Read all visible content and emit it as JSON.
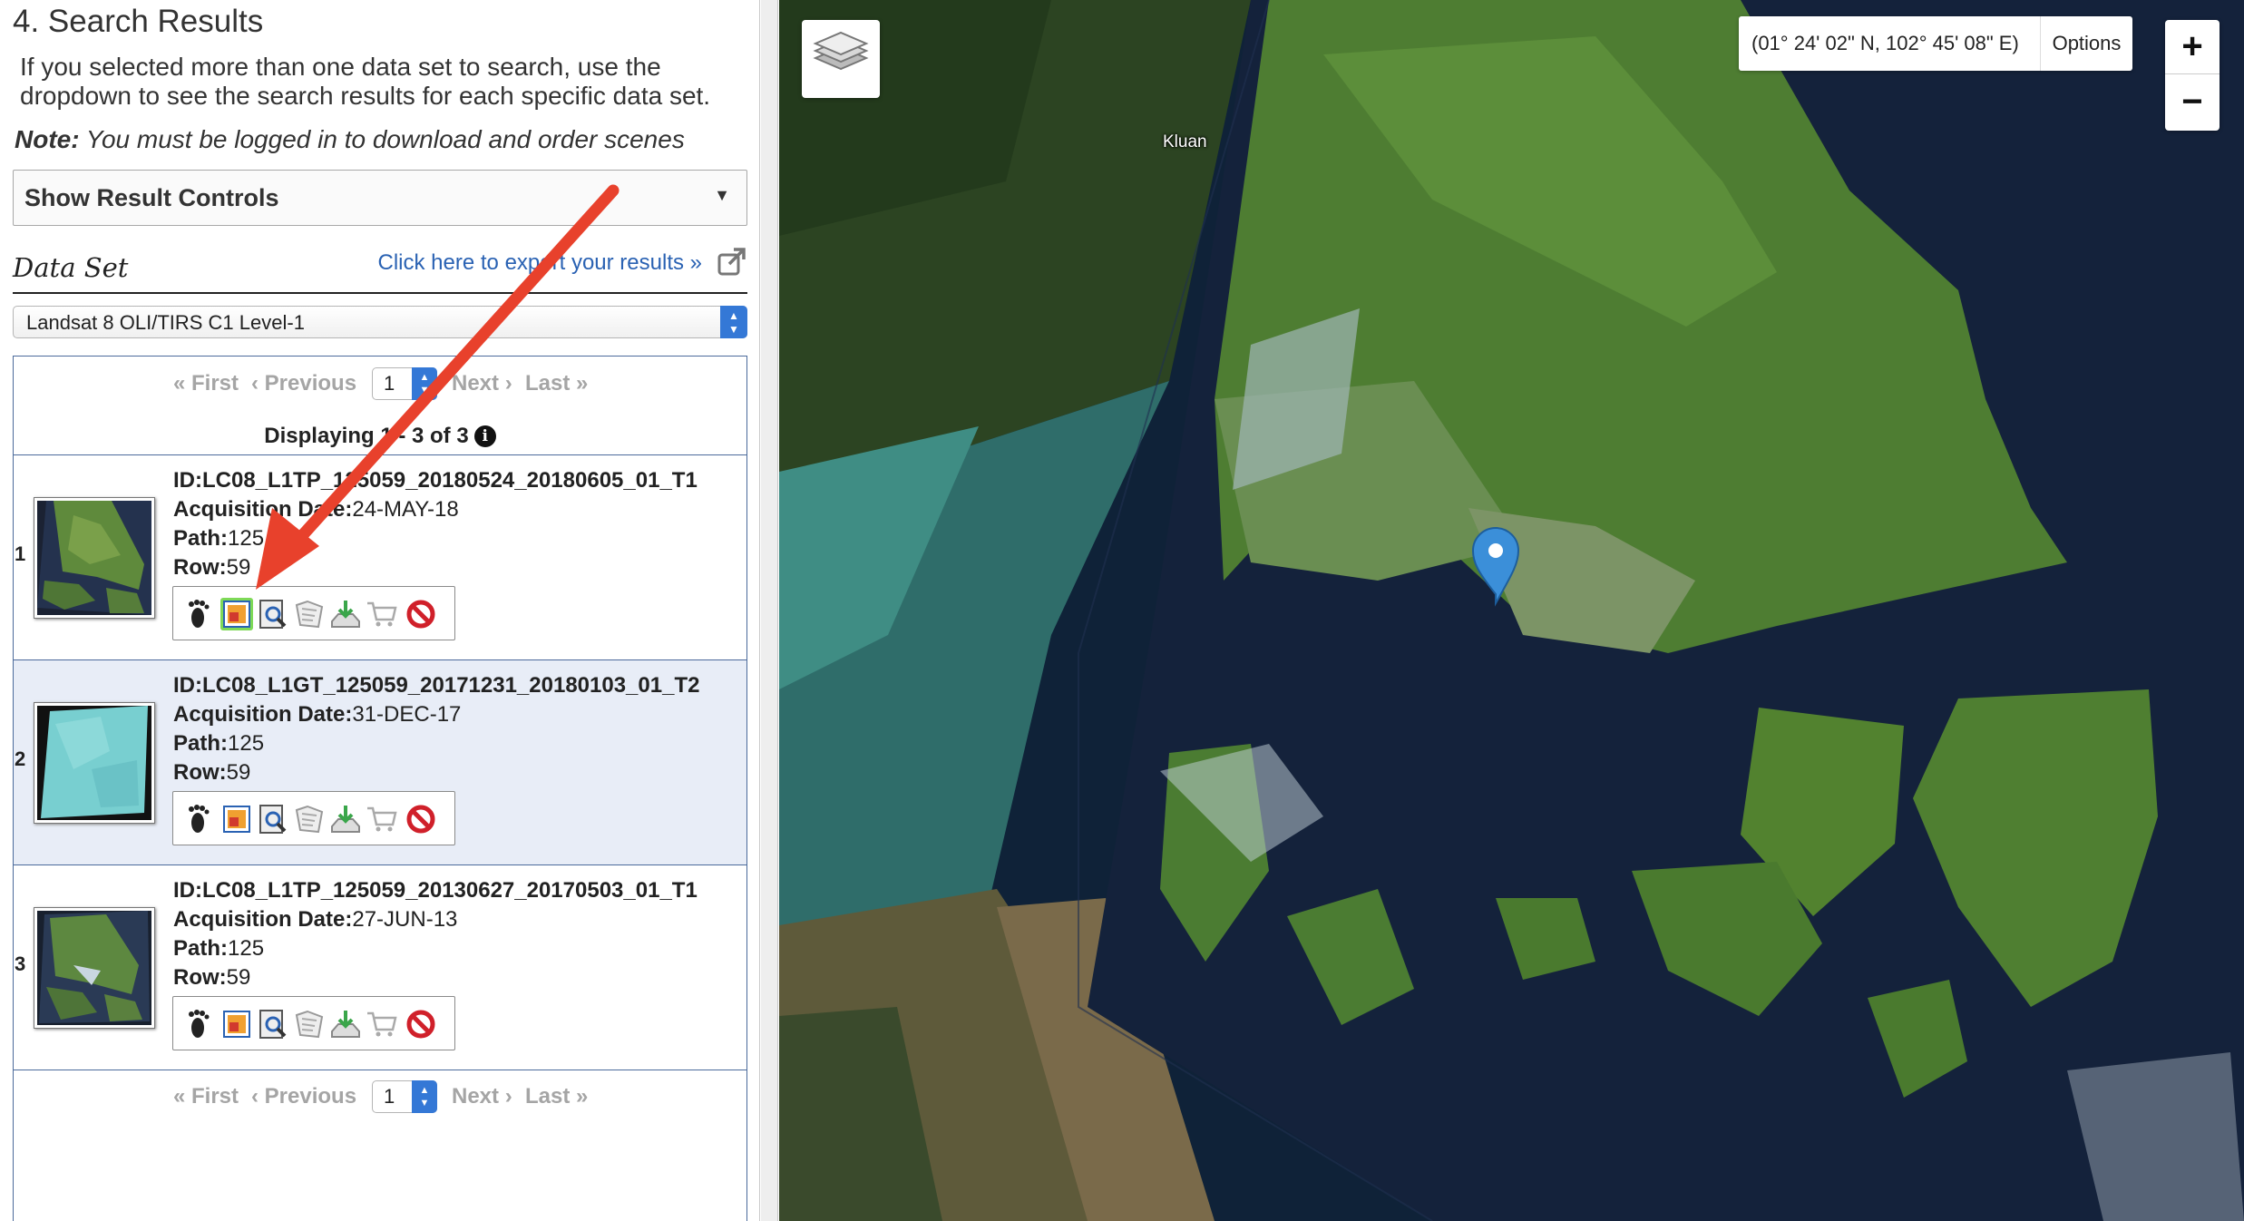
{
  "panel": {
    "section_title": "4. Search Results",
    "intro": "If you selected more than one data set to search, use the dropdown to see the search results for each specific data set.",
    "note_label": "Note:",
    "note_text": " You must be logged in to download and order scenes",
    "result_controls_label": "Show Result Controls",
    "dataset_label": "Data Set",
    "export_link": "Click here to export your results »",
    "dataset_value": "Landsat 8 OLI/TIRS C1 Level-1"
  },
  "pager": {
    "first": "« First",
    "previous": "‹ Previous",
    "page": "1",
    "next": "Next ›",
    "last": "Last »",
    "displaying": "Displaying 1 - 3 of 3"
  },
  "labels": {
    "acq": "Acquisition Date:",
    "path": "Path:",
    "row": "Row:"
  },
  "results": [
    {
      "index": "1",
      "id": "ID:LC08_L1TP_125059_20180524_20180605_01_T1",
      "acquisition": "24-MAY-18",
      "path": "125",
      "row": "59"
    },
    {
      "index": "2",
      "id": "ID:LC08_L1GT_125059_20171231_20180103_01_T2",
      "acquisition": "31-DEC-17",
      "path": "125",
      "row": "59"
    },
    {
      "index": "3",
      "id": "ID:LC08_L1TP_125059_20130627_20170503_01_T1",
      "acquisition": "27-JUN-13",
      "path": "125",
      "row": "59"
    }
  ],
  "toolbar_icons": [
    "footprint-icon",
    "browse-overlay-icon",
    "metadata-icon",
    "compare-icon",
    "download-icon",
    "cart-icon",
    "exclude-icon"
  ],
  "map": {
    "coordinates": "(01° 24' 02\" N, 102° 45' 08\" E)",
    "options_label": "Options",
    "zoom_in": "+",
    "zoom_out": "−",
    "place_label": "Kluan"
  },
  "colors": {
    "link": "#2a62b3",
    "select_blue": "#3478d6",
    "alt_row": "#e8edf7",
    "arrow": "#e8412c",
    "marker": "#3b8fd9"
  }
}
